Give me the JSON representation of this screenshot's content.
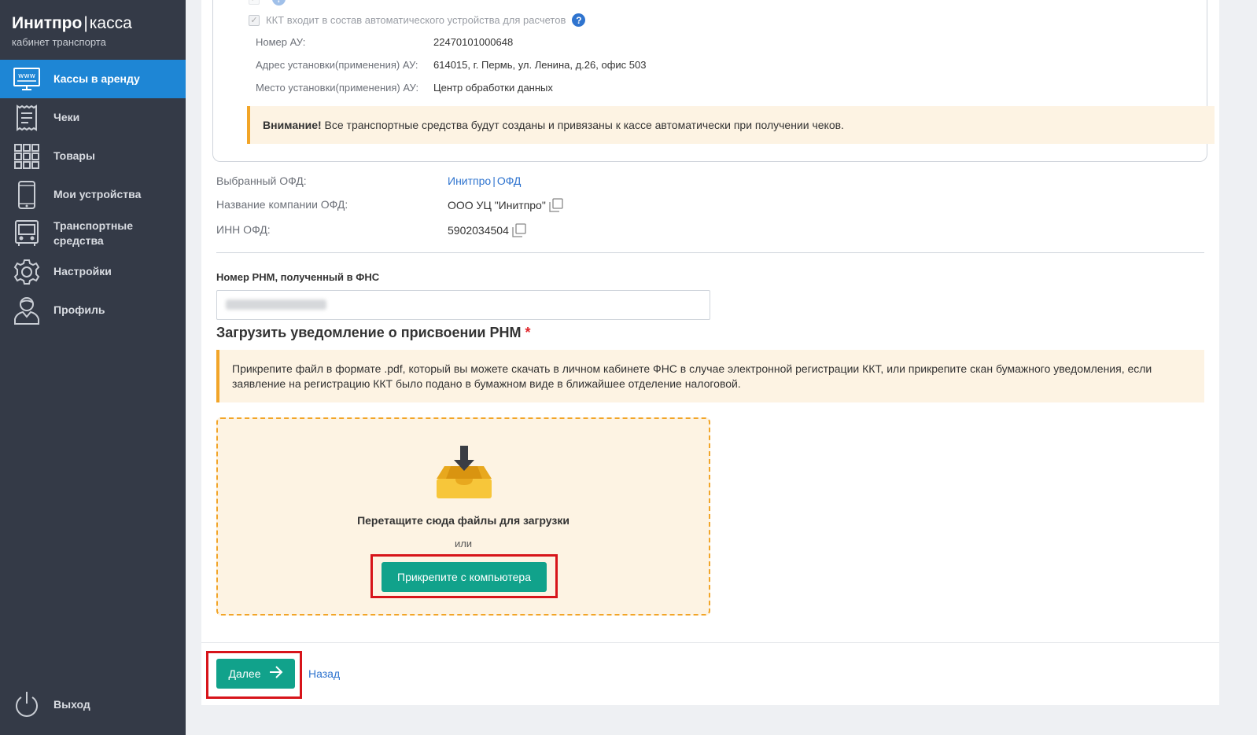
{
  "app": {
    "title": "Инитпро",
    "title_separator": "|",
    "title_suffix": "касса",
    "subtitle": "кабинет транспорта"
  },
  "sidebar": {
    "items": [
      {
        "label": "Кассы в аренду",
        "icon": "www-monitor-icon",
        "active": true
      },
      {
        "label": "Чеки",
        "icon": "receipt-icon"
      },
      {
        "label": "Товары",
        "icon": "grid-icon"
      },
      {
        "label": "Мои устройства",
        "icon": "phone-icon"
      },
      {
        "label": "Транспортные средства",
        "icon": "bus-icon"
      },
      {
        "label": "Настройки",
        "icon": "gear-icon"
      },
      {
        "label": "Профиль",
        "icon": "user-icon"
      }
    ],
    "logout_label": "Выход"
  },
  "au": {
    "checkbox_label": "ККТ входит в состав автоматического устройства для расчетов",
    "checkbox_checked": true,
    "help_symbol": "?",
    "fields": [
      {
        "label": "Номер АУ:",
        "value": "22470101000648"
      },
      {
        "label": "Адрес установки(применения) АУ:",
        "value": "614015, г. Пермь, ул. Ленина, д.26, офис 503"
      },
      {
        "label": "Место установки(применения) АУ:",
        "value": "Центр обработки данных"
      }
    ],
    "warning_bold": "Внимание!",
    "warning_text": " Все транспортные средства будут созданы и привязаны к кассе автоматически при получении чеков."
  },
  "ofd": {
    "selected_label": "Выбранный ОФД:",
    "selected_value_part1": "Инитпро",
    "selected_value_sep": "|",
    "selected_value_part2": "ОФД",
    "company_label": "Название компании ОФД:",
    "company_value": "ООО УЦ \"Инитпро\"",
    "inn_label": "ИНН ОФД:",
    "inn_value": "5902034504"
  },
  "rnm": {
    "label": "Номер РНМ, полученный в ФНС"
  },
  "upload": {
    "title": "Загрузить уведомление о присвоении РНМ",
    "required_mark": "*",
    "info": "Прикрепите файл в формате .pdf, который вы можете скачать в личном кабинете ФНС в случае электронной регистрации ККТ, или прикрепите скан бумажного уведомления, если заявление на регистрацию ККТ было подано в бумажном виде в ближайшее отделение налоговой.",
    "drop_text": "Перетащите сюда файлы для загрузки",
    "or_text": "или",
    "attach_button": "Прикрепите с компьютера"
  },
  "footer": {
    "next_button": "Далее",
    "back_link": "Назад"
  },
  "colors": {
    "sidebar_bg": "#343a47",
    "active_item": "#1e86d5",
    "primary_button": "#11a28b",
    "warning_border": "#f2a528",
    "warning_bg": "#fdf3e3",
    "highlight_frame": "#d7141a",
    "link": "#2f74cf"
  }
}
